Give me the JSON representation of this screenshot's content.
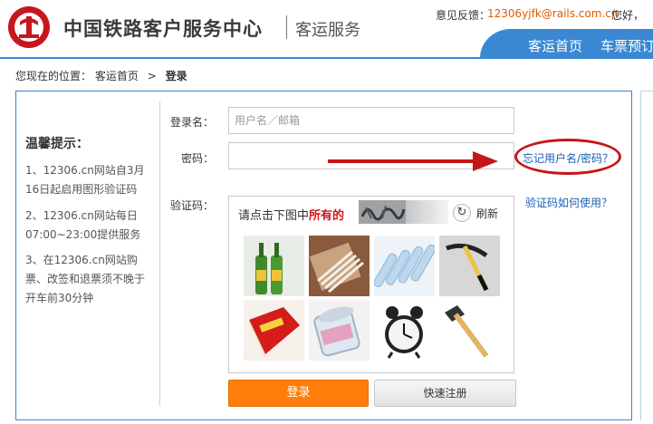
{
  "header": {
    "brand_title": "中国铁路客户服务中心",
    "brand_subtitle": "客运服务",
    "feedback_label": "意见反馈：",
    "feedback_email": "12306yjfk@rails.com.cn",
    "greeting": "您好，",
    "nav": [
      {
        "label": "客运首页"
      },
      {
        "label": "车票预订"
      }
    ],
    "colors": {
      "accent": "#3a88d2",
      "logo_red": "#c8161d"
    }
  },
  "breadcrumb": {
    "prefix": "您现在的位置：",
    "home": "客运首页",
    "separator": ">",
    "current": "登录"
  },
  "tips": {
    "title": "温馨提示：",
    "items": [
      "1、12306.cn网站自3月16日起启用图形验证码",
      "2、12306.cn网站每日07:00~23:00提供服务",
      "3、在12306.cn网站购票、改签和退票须不晚于开车前30分钟"
    ]
  },
  "form": {
    "username_label": "登录名：",
    "username_placeholder": "用户名／邮箱",
    "password_label": "密码：",
    "captcha_label": "验证码：",
    "forgot_link": "忘记用户名/密码？",
    "captcha_help_link": "验证码如何使用？",
    "annotation_color": "#c41616"
  },
  "captcha": {
    "prompt_prefix": "请点击下图中",
    "prompt_emphasis": "所有的",
    "refresh_label": "刷新",
    "images": [
      {
        "icon": "green-bottles"
      },
      {
        "icon": "cotton-swabs"
      },
      {
        "icon": "test-tubes"
      },
      {
        "icon": "pickaxe"
      },
      {
        "icon": "dictionary-book"
      },
      {
        "icon": "swab-container"
      },
      {
        "icon": "alarm-clock"
      },
      {
        "icon": "hammer"
      }
    ]
  },
  "buttons": {
    "login": "登录",
    "register": "快速注册",
    "login_color": "#ff7d0a"
  }
}
